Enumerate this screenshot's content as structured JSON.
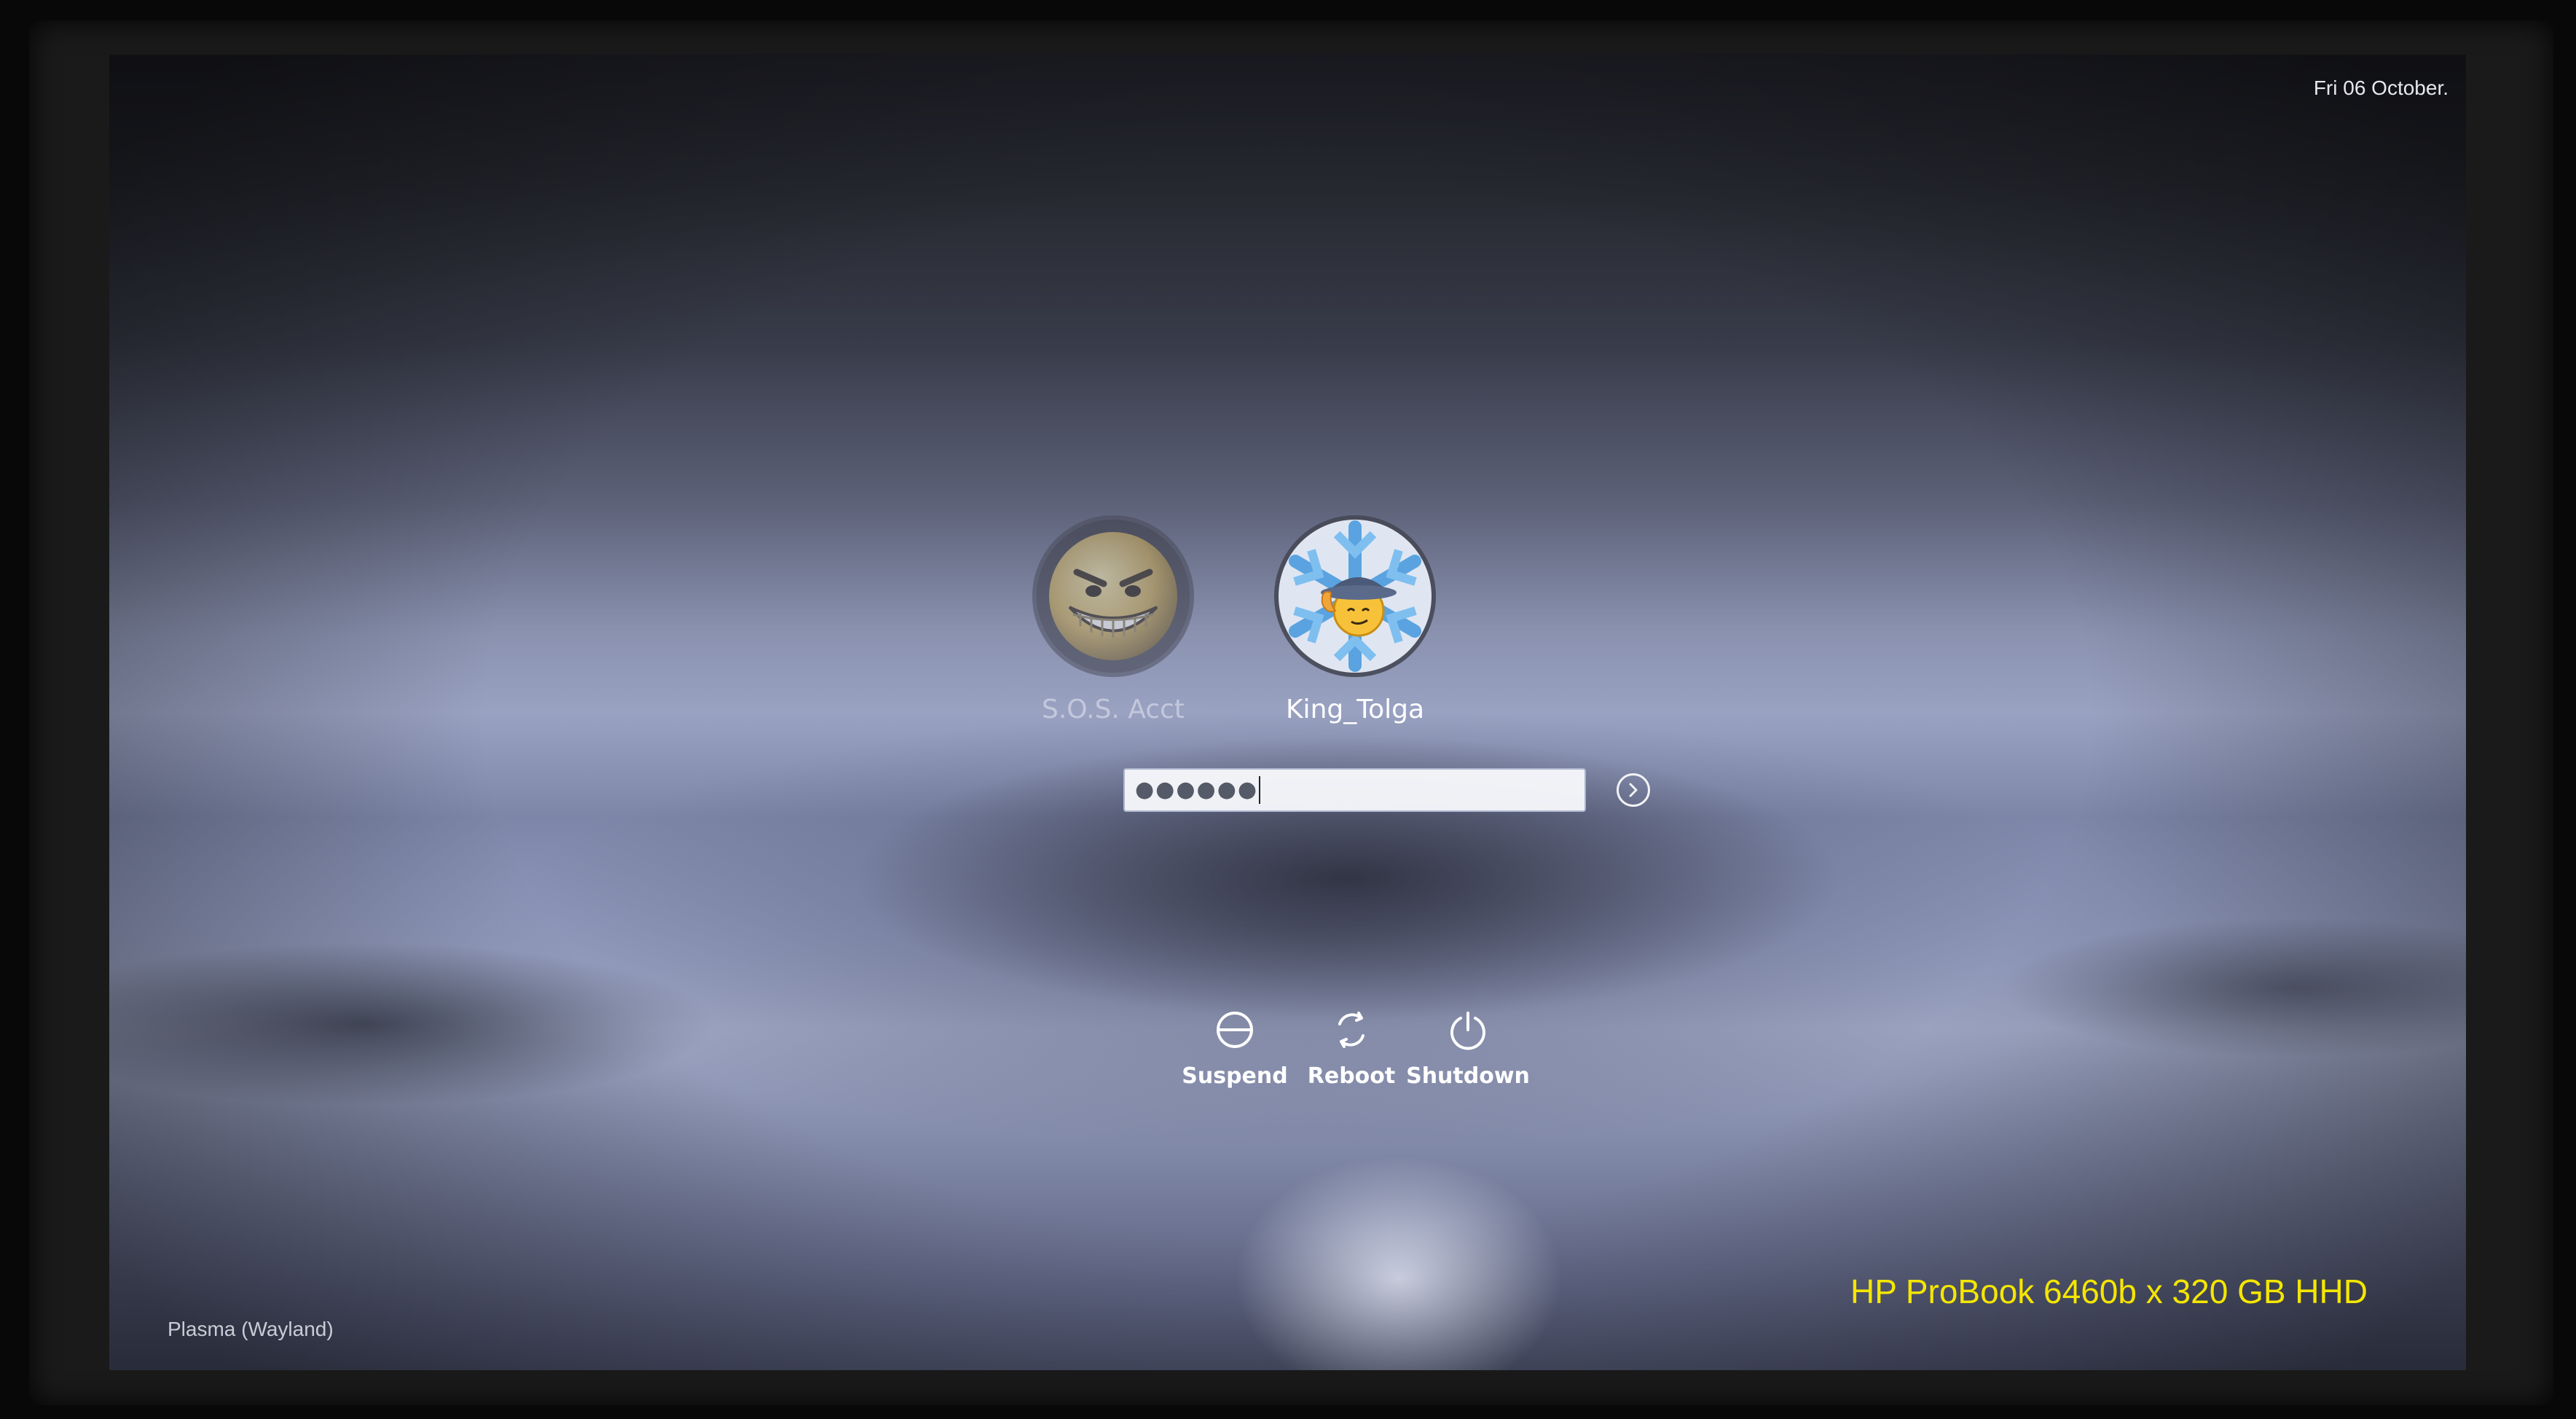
{
  "clock": {
    "text": "Fri 06 October."
  },
  "users": [
    {
      "name": "S.O.S. Acct",
      "avatar_icon": "grinning-face-icon",
      "selected": false
    },
    {
      "name": "King_Tolga",
      "avatar_icon": "snowflake-cowboy-avatar-icon",
      "selected": true
    }
  ],
  "password": {
    "masked_value": "●●●●●●",
    "login_icon": "arrow-right-circle-icon"
  },
  "actions": [
    {
      "label": "Suspend",
      "icon": "suspend-icon"
    },
    {
      "label": "Reboot",
      "icon": "reboot-icon"
    },
    {
      "label": "Shutdown",
      "icon": "power-icon"
    }
  ],
  "session": {
    "label": "Plasma (Wayland)"
  },
  "caption": {
    "text": "HP ProBook 6460b x 320 GB HHD",
    "color": "#f5e600"
  }
}
